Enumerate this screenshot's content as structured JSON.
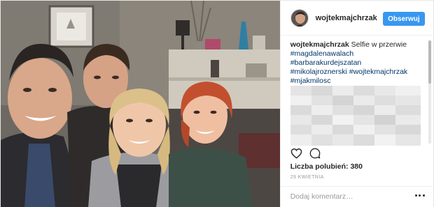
{
  "post": {
    "author": "wojtekmajchrzak",
    "follow_label": "Obserwuj",
    "caption_text": "Selfie w przerwie",
    "hashtags": [
      "#magdalenawalach",
      "#barbarakurdejszatan",
      "#mikolajroznerski",
      "#wojtekmajchrzak",
      "#mjakmilosc"
    ],
    "likes_label": "Liczba polubień: 380",
    "date": "29 KWIETNIA",
    "comment_placeholder": "Dodaj komentarz…"
  },
  "icons": {
    "like": "heart-outline-icon",
    "comment": "speech-bubble-icon",
    "more": "ellipsis-icon"
  },
  "colors": {
    "follow_button": "#3897f0",
    "hashtag": "#003569",
    "muted": "#999999"
  }
}
